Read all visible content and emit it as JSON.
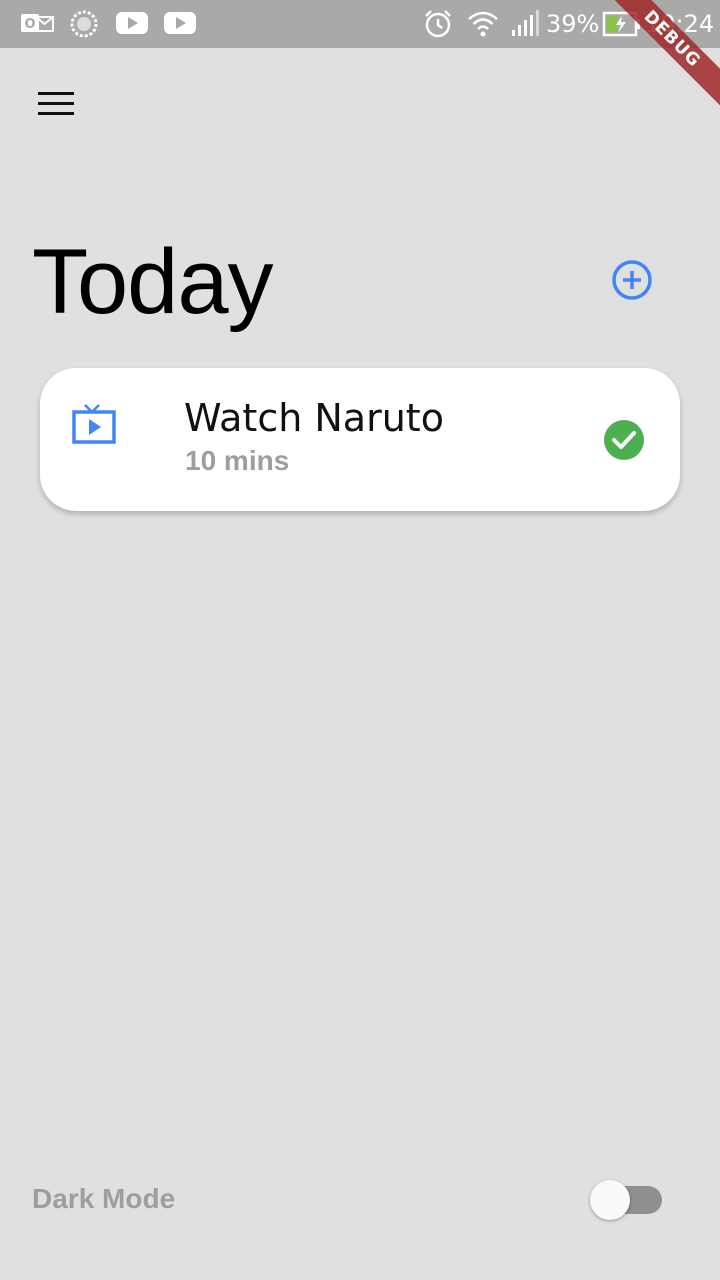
{
  "status_bar": {
    "notification_icons": [
      "outlook-icon",
      "loading-icon",
      "youtube-icon",
      "youtube-icon"
    ],
    "system_icons": [
      "alarm-icon",
      "wifi-icon",
      "signal-icon",
      "battery-charging-icon"
    ],
    "battery_percent": "39%",
    "time": "19:24"
  },
  "debug_banner": "DEBUG",
  "header": {
    "menu_icon": "menu-icon",
    "title": "Today",
    "add_icon": "add-circle-icon"
  },
  "tasks": [
    {
      "icon": "tv-icon",
      "title": "Watch Naruto",
      "duration": "10 mins",
      "status_icon": "check-circle-icon",
      "completed": true
    }
  ],
  "settings": {
    "dark_mode_label": "Dark Mode",
    "dark_mode_enabled": false
  },
  "colors": {
    "background": "#e0e0e0",
    "accent_blue": "#4285f4",
    "check_green": "#4caf50",
    "muted_text": "#9e9e9e",
    "status_bar": "#a9a9a9"
  }
}
